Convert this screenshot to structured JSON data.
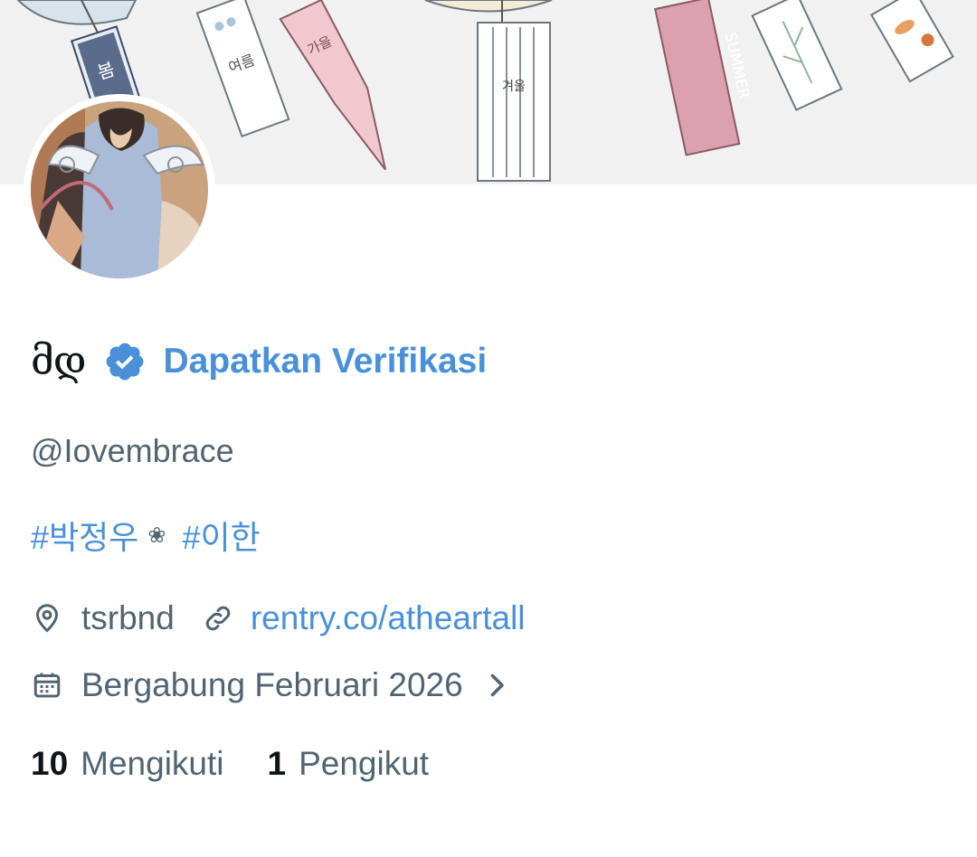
{
  "profile": {
    "display_name": "მდ",
    "verify_label": "Dapatkan Verifikasi",
    "handle": "@Iovembrace",
    "bio": {
      "tag1": "#박정우",
      "flower": "❀",
      "tag2": "#이한"
    },
    "location": "tsrbnd",
    "website": "rentry.co/atheartall",
    "joined": "Bergabung Februari 2026",
    "following_count": "10",
    "following_label": "Mengikuti",
    "followers_count": "1",
    "followers_label": "Pengikut"
  },
  "banner": {
    "tag_texts": [
      "봄",
      "여름",
      "가을",
      "겨울",
      "SUMMER"
    ]
  },
  "icons": {
    "verified": "verified-badge-icon",
    "location": "location-pin-icon",
    "link": "link-icon",
    "calendar": "calendar-icon",
    "chevron": "chevron-right-icon"
  },
  "colors": {
    "accent": "#4a90d9",
    "text_primary": "#0f1419",
    "text_secondary": "#536471",
    "banner_bg": "#f1f1f1"
  }
}
